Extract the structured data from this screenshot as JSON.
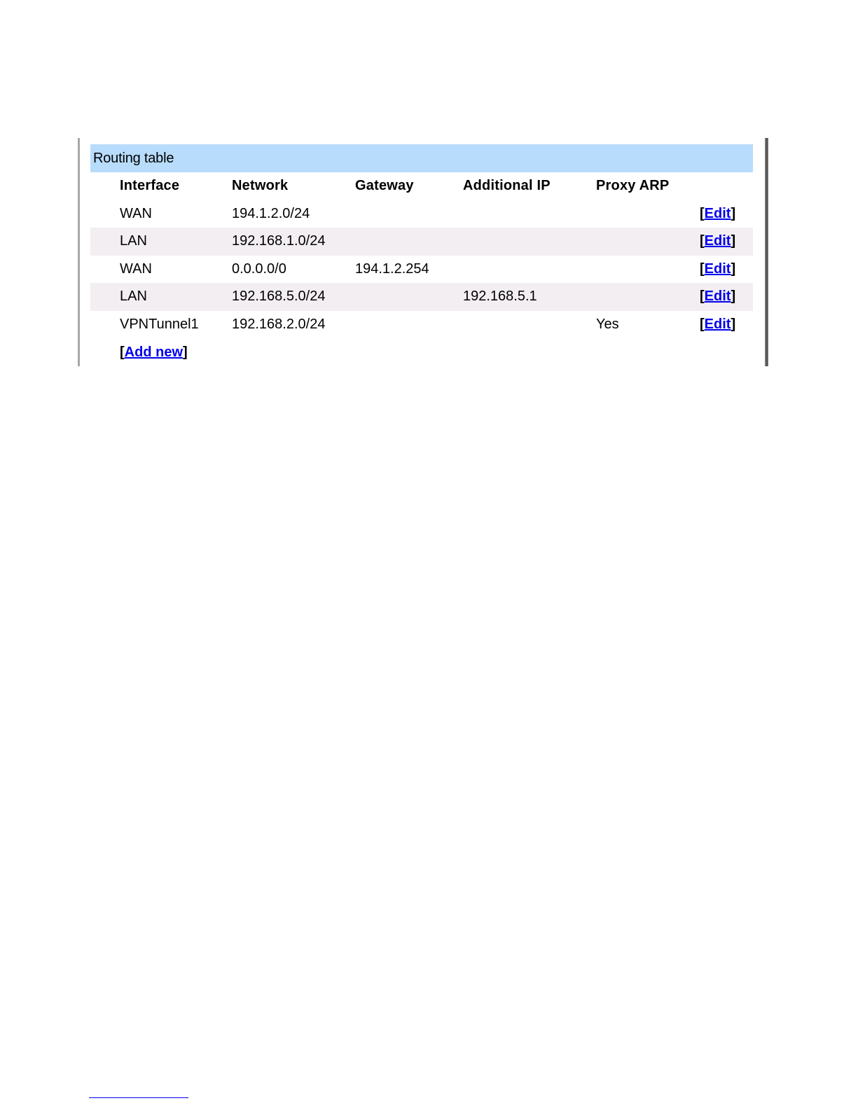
{
  "panel": {
    "title": "Routing table"
  },
  "table": {
    "headers": [
      "Interface",
      "Network",
      "Gateway",
      "Additional IP",
      "Proxy ARP"
    ],
    "rows": [
      {
        "interface": "WAN",
        "network": "194.1.2.0/24",
        "gateway": "",
        "additional_ip": "",
        "proxy_arp": "",
        "action": "Edit"
      },
      {
        "interface": "LAN",
        "network": "192.168.1.0/24",
        "gateway": "",
        "additional_ip": "",
        "proxy_arp": "",
        "action": "Edit"
      },
      {
        "interface": "WAN",
        "network": "0.0.0.0/0",
        "gateway": "194.1.2.254",
        "additional_ip": "",
        "proxy_arp": "",
        "action": "Edit"
      },
      {
        "interface": "LAN",
        "network": "192.168.5.0/24",
        "gateway": "",
        "additional_ip": "192.168.5.1",
        "proxy_arp": "",
        "action": "Edit"
      },
      {
        "interface": "VPNTunnel1",
        "network": "192.168.2.0/24",
        "gateway": "",
        "additional_ip": "",
        "proxy_arp": "Yes",
        "action": "Edit"
      }
    ],
    "add_new_label": "Add new",
    "bracket_open": "[",
    "bracket_close": "]"
  },
  "colors": {
    "title_bar": "#b8dcfc",
    "row_shade": "#f2eef2",
    "link": "#0000ee"
  }
}
